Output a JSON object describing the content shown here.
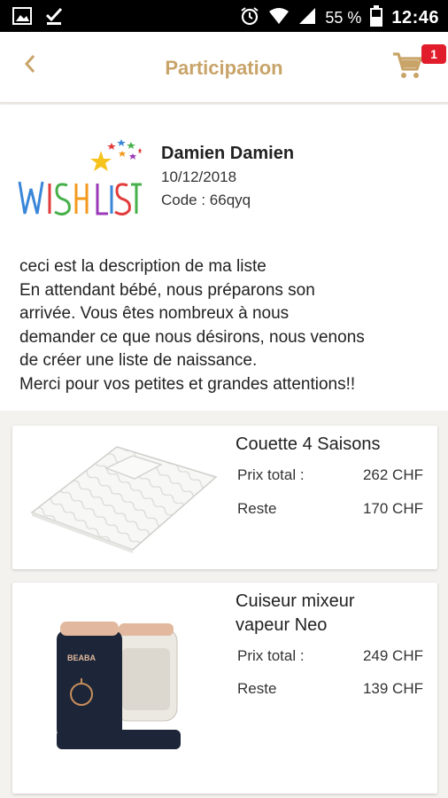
{
  "status_bar": {
    "battery_percent": "55 %",
    "time": "12:46",
    "icons": [
      "image-icon",
      "check-download-icon",
      "alarm-icon",
      "wifi-icon",
      "signal-icon",
      "battery-icon"
    ]
  },
  "header": {
    "title": "Participation",
    "cart_count": "1",
    "accent_color": "#c8a469",
    "badge_color": "#e21d2b"
  },
  "list_info": {
    "logo_text": "WISH LIST",
    "owner_name": "Damien Damien",
    "date": "10/12/2018",
    "code": "Code : 66qyq",
    "description_lines": [
      "ceci est la description de ma liste",
      "En attendant bébé, nous préparons son",
      "arrivée. Vous êtes nombreux à nous",
      "demander ce que nous désirons, nous venons",
      "de créer une liste de naissance.",
      "Merci pour vos petites et grandes attentions!!"
    ]
  },
  "products": [
    {
      "title_lines": [
        "Couette 4 Saisons"
      ],
      "total_label": "Prix total :",
      "total_value": "262 CHF",
      "remaining_label": "Reste",
      "remaining_value": "170 CHF",
      "image_icon": "duvet-image"
    },
    {
      "title_lines": [
        "Cuiseur mixeur",
        "vapeur Neo"
      ],
      "total_label": "Prix total :",
      "total_value": "249 CHF",
      "remaining_label": "Reste",
      "remaining_value": "139 CHF",
      "image_brand": "BEABA",
      "image_icon": "baby-food-maker-image"
    }
  ]
}
